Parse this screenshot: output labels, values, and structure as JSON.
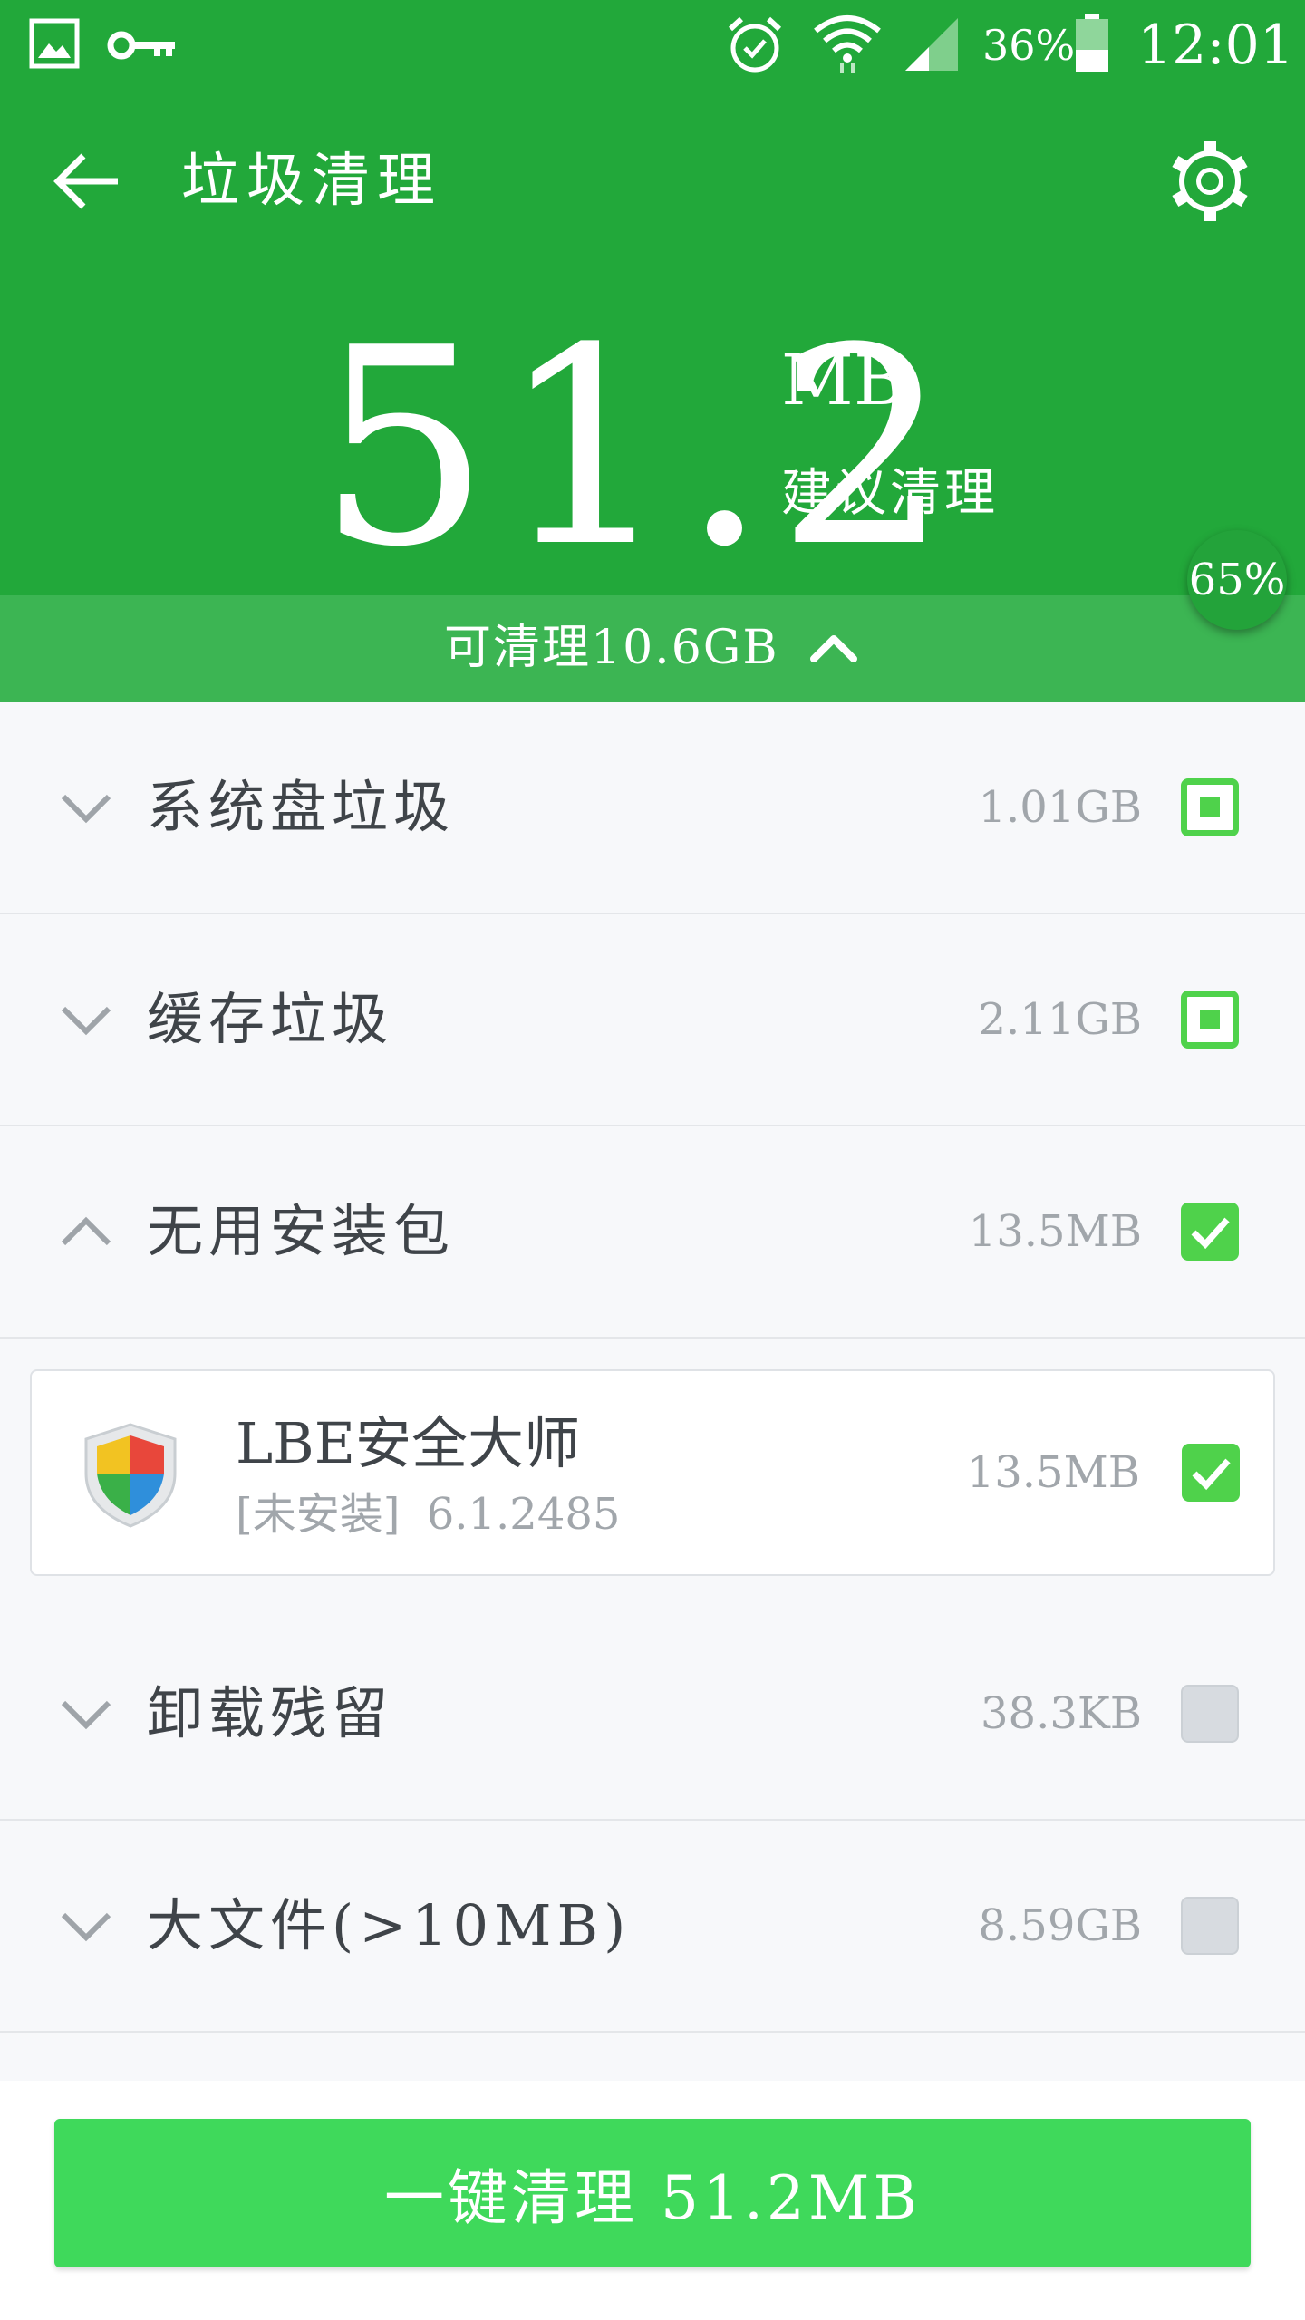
{
  "status_bar": {
    "battery_percent": "36%",
    "time": "12:01",
    "icons": [
      "image-icon",
      "key-icon",
      "alarm-icon",
      "wifi-icon",
      "signal-icon",
      "battery-icon"
    ]
  },
  "app_bar": {
    "title": "垃圾清理",
    "back_icon": "arrow-left-icon",
    "settings_icon": "gear-icon"
  },
  "summary": {
    "value": "51.2",
    "unit": "MB",
    "suggest_label": "建议清理",
    "percent": "65%",
    "total_label": "可清理10.6GB",
    "total_chevron": "chevron-up-icon"
  },
  "categories": [
    {
      "label": "系统盘垃圾",
      "size": "1.01GB",
      "state": "partial",
      "expanded": false
    },
    {
      "label": "缓存垃圾",
      "size": "2.11GB",
      "state": "partial",
      "expanded": false
    },
    {
      "label": "无用安装包",
      "size": "13.5MB",
      "state": "checked",
      "expanded": true
    },
    {
      "label": "卸载残留",
      "size": "38.3KB",
      "state": "unchecked",
      "expanded": false
    },
    {
      "label": "大文件(>10MB)",
      "size": "8.59GB",
      "state": "unchecked",
      "expanded": false
    }
  ],
  "apk_item": {
    "name": "LBE安全大师",
    "status": "[未安装] 6.1.2485",
    "size": "13.5MB",
    "state": "checked",
    "icon": "shield-icon"
  },
  "colors": {
    "header_green": "#22a83a",
    "total_bar_green": "#3cb553",
    "button_green": "#3fd95b",
    "checkbox_green": "#4fd24b"
  },
  "footer": {
    "clean_button_label": "一键清理 51.2MB"
  }
}
